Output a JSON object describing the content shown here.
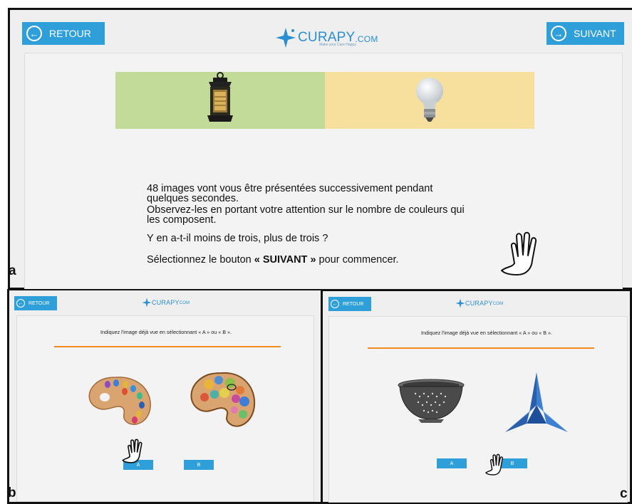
{
  "panel_a": {
    "label": "a",
    "back_button": "RETOUR",
    "next_button": "SUIVANT",
    "logo_text": "CURAPY",
    "logo_suffix": ".COM",
    "tagline": "Make your Care Happy",
    "lines": [
      "48 images vont vous être présentées successivement pendant",
      "quelques secondes.",
      "Observez-les en portant votre attention sur le nombre de couleurs qui",
      "les composent.",
      "Y en a-t-il moins de trois, plus de trois ?"
    ],
    "select_prefix": "Sélectionnez le bouton ",
    "select_bold": "« SUIVANT »",
    "select_suffix": " pour commencer.",
    "colors": {
      "green": "#c2db98",
      "yellow": "#f7df9e",
      "accent": "#2e9fd9"
    }
  },
  "panel_b": {
    "label": "b",
    "back_button": "RETOUR",
    "logo_text": "CURAPY",
    "logo_suffix": "COM",
    "instruction": "Indiquez l'image déjà vue en sélectionnant « A » ou « B ».",
    "button_a": "A",
    "button_b": "B"
  },
  "panel_c": {
    "label": "c",
    "back_button": "RETOUR",
    "logo_text": "CURAPY",
    "logo_suffix": "COM",
    "instruction": "Indiquez l'image déjà vue en sélectionnant « A » ou « B ».",
    "button_a": "A",
    "button_b": "B"
  }
}
